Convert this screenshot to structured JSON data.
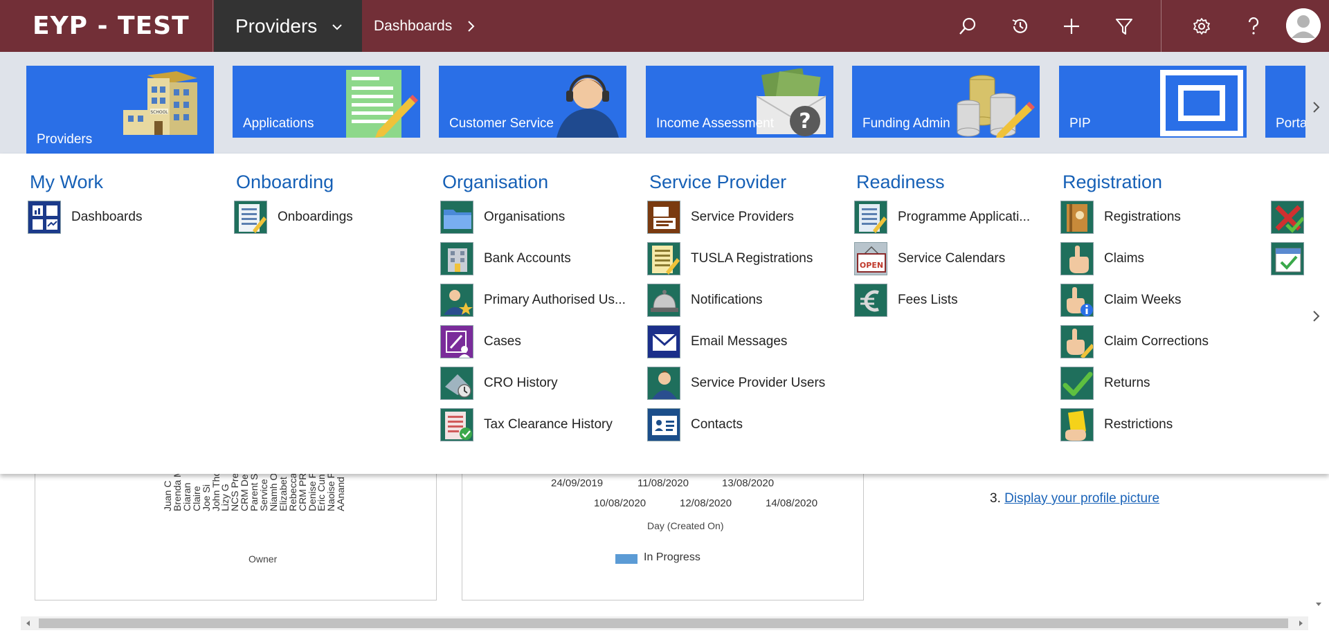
{
  "brand": {
    "title": "EYP - TEST"
  },
  "area_switcher": {
    "label": "Providers"
  },
  "breadcrumb": {
    "label": "Dashboards"
  },
  "colors": {
    "topbar": "#722f37",
    "area_switch": "#333333",
    "tile": "#2a6fe7",
    "group_title": "#1660b6",
    "link": "#1a63b8"
  },
  "toolbar": {
    "icons": [
      "search-icon",
      "history-icon",
      "plus-icon",
      "filter-icon",
      "gear-icon",
      "help-icon",
      "avatar-icon"
    ]
  },
  "tiles": [
    {
      "label": "Providers",
      "icon": "school-building-icon",
      "active": true
    },
    {
      "label": "Applications",
      "icon": "application-form-icon"
    },
    {
      "label": "Customer Service",
      "icon": "headset-agent-icon"
    },
    {
      "label": "Income Assessment",
      "icon": "money-envelope-icon"
    },
    {
      "label": "Funding Admin",
      "icon": "coin-stack-icon"
    },
    {
      "label": "PIP",
      "icon": "square-frame-icon"
    },
    {
      "label": "Porta",
      "icon": ""
    }
  ],
  "groups": [
    {
      "title": "My Work",
      "items": [
        {
          "label": "Dashboards",
          "icon": "dashboards-icon"
        }
      ]
    },
    {
      "title": "Onboarding",
      "items": [
        {
          "label": "Onboardings",
          "icon": "onboardings-icon"
        }
      ]
    },
    {
      "title": "Organisation",
      "items": [
        {
          "label": "Organisations",
          "icon": "folder-icon"
        },
        {
          "label": "Bank Accounts",
          "icon": "bank-icon"
        },
        {
          "label": "Primary Authorised Us...",
          "icon": "user-star-icon"
        },
        {
          "label": "Cases",
          "icon": "cases-icon"
        },
        {
          "label": "CRO History",
          "icon": "cro-history-icon"
        },
        {
          "label": "Tax Clearance History",
          "icon": "tax-clearance-icon"
        }
      ]
    },
    {
      "title": "Service Provider",
      "items": [
        {
          "label": "Service Providers",
          "icon": "service-providers-icon"
        },
        {
          "label": "TUSLA Registrations",
          "icon": "tusla-registrations-icon"
        },
        {
          "label": "Notifications",
          "icon": "bell-icon"
        },
        {
          "label": "Email Messages",
          "icon": "email-icon"
        },
        {
          "label": "Service Provider Users",
          "icon": "user-icon"
        },
        {
          "label": "Contacts",
          "icon": "contact-card-icon"
        }
      ]
    },
    {
      "title": "Readiness",
      "items": [
        {
          "label": "Programme Applicati...",
          "icon": "programme-application-icon"
        },
        {
          "label": "Service Calendars",
          "icon": "open-sign-icon"
        },
        {
          "label": "Fees Lists",
          "icon": "euro-icon"
        }
      ]
    },
    {
      "title": "Registration",
      "items": [
        {
          "label": "Registrations",
          "icon": "registrations-book-icon"
        },
        {
          "label": "Claims",
          "icon": "hand-claim-icon"
        },
        {
          "label": "Claim Weeks",
          "icon": "hand-info-icon"
        },
        {
          "label": "Claim Corrections",
          "icon": "hand-pencil-icon"
        },
        {
          "label": "Returns",
          "icon": "checkmark-icon"
        },
        {
          "label": "Restrictions",
          "icon": "yellow-card-icon"
        }
      ]
    },
    {
      "title": "",
      "items": [
        {
          "label": "",
          "icon": "red-cross-check-icon"
        },
        {
          "label": "",
          "icon": "calendar-check-icon"
        }
      ]
    }
  ],
  "dashboard": {
    "owner_chart": {
      "xlabel": "Owner",
      "names": [
        "Juan C",
        "Brenda M",
        "Ciaran",
        "Claire",
        "Joe Si",
        "John Thor",
        "Lizy G",
        "NCS PrePR",
        "CRM Deploy",
        "Parent S",
        "Service",
        "Niamh O'E",
        "Elizabet",
        "Rebecca",
        "CRM PRE D",
        "Denise F",
        "Eric Cunn",
        "Naoise F",
        "AAnand I"
      ]
    },
    "date_chart": {
      "xlabel": "Day (Created On)",
      "ticks_top": [
        "24/09/2019",
        "11/08/2020",
        "13/08/2020"
      ],
      "ticks_bottom": [
        "10/08/2020",
        "12/08/2020",
        "14/08/2020"
      ],
      "legend": "In Progress"
    },
    "profile_step": {
      "number": "3.",
      "link": "Display your profile picture"
    }
  }
}
